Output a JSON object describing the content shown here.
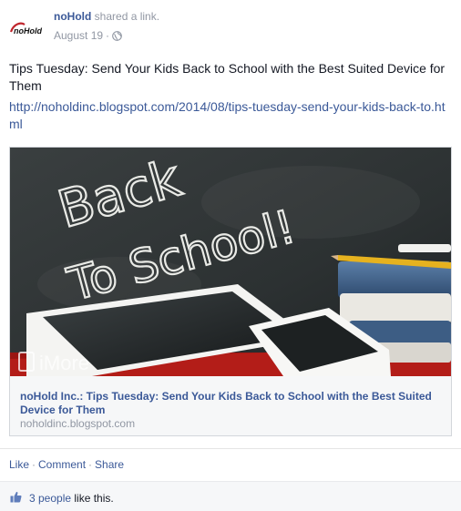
{
  "post": {
    "author": "noHold",
    "action_text": "shared a link.",
    "date": "August 19",
    "dot": "·",
    "logo_text": "noHold",
    "text": "Tips Tuesday: Send Your Kids Back to School with the Best Suited Device for Them",
    "url": "http://noholdinc.blogspot.com/2014/08/tips-tuesday-send-your-kids-back-to.html"
  },
  "link_card": {
    "image_chalk_line1": "Back",
    "image_chalk_line2": "To School!",
    "image_watermark": "iMore",
    "title": "noHold Inc.: Tips Tuesday: Send Your Kids Back to School with the Best Suited Device for Them",
    "domain": "noholdinc.blogspot.com"
  },
  "actions": {
    "like": "Like",
    "comment": "Comment",
    "share": "Share",
    "sep": "·"
  },
  "likes": {
    "count_link": "3 people",
    "suffix": " like this."
  },
  "colors": {
    "link_blue": "#3b5998",
    "meta_gray": "#9197a3",
    "text": "#141823",
    "likes_bg": "#f6f7f9"
  },
  "icons": {
    "privacy": "globe-icon",
    "likes": "thumbs-up-icon"
  }
}
